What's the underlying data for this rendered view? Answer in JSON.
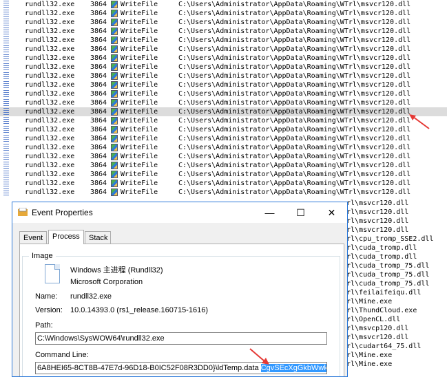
{
  "events": [
    {
      "process": "rundll32.exe",
      "pid": "3864",
      "operation": "WriteFile",
      "path": "C:\\Users\\Administrator\\AppData\\Roaming\\WTrl\\msvcr120.dll"
    },
    {
      "process": "rundll32.exe",
      "pid": "3864",
      "operation": "WriteFile",
      "path": "C:\\Users\\Administrator\\AppData\\Roaming\\WTrl\\msvcr120.dll"
    },
    {
      "process": "rundll32.exe",
      "pid": "3864",
      "operation": "WriteFile",
      "path": "C:\\Users\\Administrator\\AppData\\Roaming\\WTrl\\msvcr120.dll"
    },
    {
      "process": "rundll32.exe",
      "pid": "3864",
      "operation": "WriteFile",
      "path": "C:\\Users\\Administrator\\AppData\\Roaming\\WTrl\\msvcr120.dll"
    },
    {
      "process": "rundll32.exe",
      "pid": "3864",
      "operation": "WriteFile",
      "path": "C:\\Users\\Administrator\\AppData\\Roaming\\WTrl\\msvcr120.dll"
    },
    {
      "process": "rundll32.exe",
      "pid": "3864",
      "operation": "WriteFile",
      "path": "C:\\Users\\Administrator\\AppData\\Roaming\\WTrl\\msvcr120.dll"
    },
    {
      "process": "rundll32.exe",
      "pid": "3864",
      "operation": "WriteFile",
      "path": "C:\\Users\\Administrator\\AppData\\Roaming\\WTrl\\msvcr120.dll"
    },
    {
      "process": "rundll32.exe",
      "pid": "3864",
      "operation": "WriteFile",
      "path": "C:\\Users\\Administrator\\AppData\\Roaming\\WTrl\\msvcr120.dll"
    },
    {
      "process": "rundll32.exe",
      "pid": "3864",
      "operation": "WriteFile",
      "path": "C:\\Users\\Administrator\\AppData\\Roaming\\WTrl\\msvcr120.dll"
    },
    {
      "process": "rundll32.exe",
      "pid": "3864",
      "operation": "WriteFile",
      "path": "C:\\Users\\Administrator\\AppData\\Roaming\\WTrl\\msvcr120.dll"
    },
    {
      "process": "rundll32.exe",
      "pid": "3864",
      "operation": "WriteFile",
      "path": "C:\\Users\\Administrator\\AppData\\Roaming\\WTrl\\msvcr120.dll"
    },
    {
      "process": "rundll32.exe",
      "pid": "3864",
      "operation": "WriteFile",
      "path": "C:\\Users\\Administrator\\AppData\\Roaming\\WTrl\\msvcr120.dll"
    },
    {
      "process": "rundll32.exe",
      "pid": "3864",
      "operation": "WriteFile",
      "path": "C:\\Users\\Administrator\\AppData\\Roaming\\WTrl\\msvcr120.dll",
      "selected": true
    },
    {
      "process": "rundll32.exe",
      "pid": "3864",
      "operation": "WriteFile",
      "path": "C:\\Users\\Administrator\\AppData\\Roaming\\WTrl\\msvcr120.dll"
    },
    {
      "process": "rundll32.exe",
      "pid": "3864",
      "operation": "WriteFile",
      "path": "C:\\Users\\Administrator\\AppData\\Roaming\\WTrl\\msvcr120.dll"
    },
    {
      "process": "rundll32.exe",
      "pid": "3864",
      "operation": "WriteFile",
      "path": "C:\\Users\\Administrator\\AppData\\Roaming\\WTrl\\msvcr120.dll"
    },
    {
      "process": "rundll32.exe",
      "pid": "3864",
      "operation": "WriteFile",
      "path": "C:\\Users\\Administrator\\AppData\\Roaming\\WTrl\\msvcr120.dll"
    },
    {
      "process": "rundll32.exe",
      "pid": "3864",
      "operation": "WriteFile",
      "path": "C:\\Users\\Administrator\\AppData\\Roaming\\WTrl\\msvcr120.dll"
    },
    {
      "process": "rundll32.exe",
      "pid": "3864",
      "operation": "WriteFile",
      "path": "C:\\Users\\Administrator\\AppData\\Roaming\\WTrl\\msvcr120.dll"
    },
    {
      "process": "rundll32.exe",
      "pid": "3864",
      "operation": "WriteFile",
      "path": "C:\\Users\\Administrator\\AppData\\Roaming\\WTrl\\msvcr120.dll"
    },
    {
      "process": "rundll32.exe",
      "pid": "3864",
      "operation": "WriteFile",
      "path": "C:\\Users\\Administrator\\AppData\\Roaming\\WTrl\\msvcr120.dll"
    },
    {
      "process": "rundll32.exe",
      "pid": "3864",
      "operation": "WriteFile",
      "path": "C:\\Users\\Administrator\\AppData\\Roaming\\WTrl\\msvcr120.dll"
    }
  ],
  "hidden_path_tails": [
    "rl\\msvcr120.dll",
    "rl\\msvcr120.dll",
    "rl\\msvcr120.dll",
    "rl\\msvcr120.dll",
    "rl\\cpu_tromp_SSE2.dll",
    "rl\\cuda_tromp.dll",
    "rl\\cuda_tromp.dll",
    "rl\\cuda_tromp_75.dll",
    "rl\\cuda_tromp_75.dll",
    "rl\\cuda_tromp_75.dll",
    "rl\\feilaifeiqu.dll",
    "rl\\Mine.exe",
    "rl\\ThundCloud.exe",
    "rl\\OpenCL.dll",
    "rl\\msvcp120.dll",
    "rl\\msvcr120.dll",
    "rl\\cudart64_75.dll",
    "rl\\Mine.exe",
    "rl\\Mine.exe"
  ],
  "dialog": {
    "title": "Event Properties",
    "minimize": "—",
    "maximize": "☐",
    "close": "✕",
    "tabs": [
      "Event",
      "Process",
      "Stack"
    ],
    "active_tab": "Process",
    "image_group_label": "Image",
    "image_name": "Windows 主进程 (Rundll32)",
    "company": "Microsoft Corporation",
    "name_label": "Name:",
    "name_value": "rundll32.exe",
    "version_label": "Version:",
    "version_value": "10.0.14393.0 (rs1_release.160715-1616)",
    "path_label": "Path:",
    "path_value": "C:\\Windows\\SysWOW64\\rundll32.exe",
    "cmd_label": "Command Line:",
    "cmd_value": "6A8HEI65-8CT8B-47E7d-96D18-B0IC52F08R3DD0}\\ldTemp.data ",
    "cmd_selected": "CgvSEcXgGkbWwkFa"
  },
  "colors": {
    "accent": "#2b78d8",
    "arrow": "#e53935",
    "selection": "#3399ff"
  },
  "icons": {
    "arrow": "red-arrow-icon",
    "op": "write-file-icon"
  }
}
